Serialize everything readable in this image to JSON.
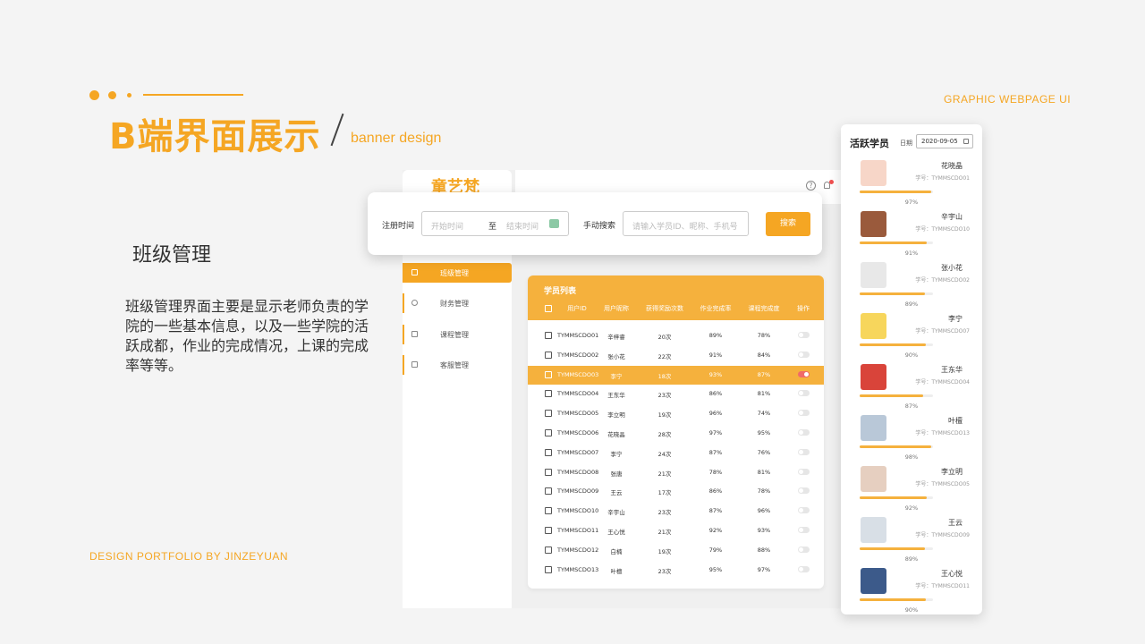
{
  "header": {
    "title": "B端界面展示",
    "subtitle": "banner design",
    "top_right": "GRAPHIC WEBPAGE UI",
    "footer": "DESIGN PORTFOLIO BY JINZEYUAN",
    "accent_color": "#f5a623"
  },
  "intro": {
    "title": "班级管理",
    "description": "班级管理界面主要是显示老师负责的学院的一些基本信息，以及一些学院的活跃成都，作业的完成情况，上课的完成率等等。"
  },
  "app": {
    "logo": "童艺梵",
    "help_icon": "?",
    "nav": [
      {
        "label": "班级管理",
        "icon": "clipboard-icon",
        "active": true
      },
      {
        "label": "财务管理",
        "icon": "yen-icon",
        "active": false
      },
      {
        "label": "课程管理",
        "icon": "book-icon",
        "active": false
      },
      {
        "label": "客服管理",
        "icon": "headset-icon",
        "active": false
      }
    ],
    "filter": {
      "reg_label": "注册时间",
      "start_placeholder": "开始时间",
      "to": "至",
      "end_placeholder": "结束时间",
      "search_label": "手动搜索",
      "search_placeholder": "请输入学员ID、昵称、手机号",
      "search_button": "搜索"
    },
    "table": {
      "title": "学员列表",
      "headers": [
        "用户ID",
        "用户昵称",
        "获得奖励次数",
        "作业完成率",
        "课程完成度",
        "操作"
      ],
      "rows": [
        {
          "id": "TYMMSCDO01",
          "name": "辛梓睿",
          "rewards": "20次",
          "homework": "89%",
          "course": "78%",
          "on": false,
          "selected": false
        },
        {
          "id": "TYMMSCDO02",
          "name": "张小花",
          "rewards": "22次",
          "homework": "91%",
          "course": "84%",
          "on": false,
          "selected": false
        },
        {
          "id": "TYMMSCDO03",
          "name": "李宁",
          "rewards": "18次",
          "homework": "93%",
          "course": "87%",
          "on": true,
          "selected": true
        },
        {
          "id": "TYMMSCDO04",
          "name": "王东华",
          "rewards": "23次",
          "homework": "86%",
          "course": "81%",
          "on": false,
          "selected": false
        },
        {
          "id": "TYMMSCDO05",
          "name": "李立明",
          "rewards": "19次",
          "homework": "96%",
          "course": "74%",
          "on": false,
          "selected": false
        },
        {
          "id": "TYMMSCDO06",
          "name": "花晓晶",
          "rewards": "28次",
          "homework": "97%",
          "course": "95%",
          "on": false,
          "selected": false
        },
        {
          "id": "TYMMSCDO07",
          "name": "李宁",
          "rewards": "24次",
          "homework": "87%",
          "course": "76%",
          "on": false,
          "selected": false
        },
        {
          "id": "TYMMSCDO08",
          "name": "张唐",
          "rewards": "21次",
          "homework": "78%",
          "course": "81%",
          "on": false,
          "selected": false
        },
        {
          "id": "TYMMSCDO09",
          "name": "王云",
          "rewards": "17次",
          "homework": "86%",
          "course": "78%",
          "on": false,
          "selected": false
        },
        {
          "id": "TYMMSCDO10",
          "name": "辛宇山",
          "rewards": "23次",
          "homework": "87%",
          "course": "96%",
          "on": false,
          "selected": false
        },
        {
          "id": "TYMMSCDO11",
          "name": "王心悦",
          "rewards": "21次",
          "homework": "92%",
          "course": "93%",
          "on": false,
          "selected": false
        },
        {
          "id": "TYMMSCDO12",
          "name": "白楠",
          "rewards": "19次",
          "homework": "79%",
          "course": "88%",
          "on": false,
          "selected": false
        },
        {
          "id": "TYMMSCDO13",
          "name": "叶檀",
          "rewards": "23次",
          "homework": "95%",
          "course": "97%",
          "on": false,
          "selected": false
        }
      ]
    }
  },
  "active_panel": {
    "title": "活跃学员",
    "date_label": "日期",
    "date": "2020-09-05",
    "students": [
      {
        "name": "花晓晶",
        "id": "学号：TYMMSCDO01",
        "percent": 97,
        "pct_label": "97%",
        "avatar_color": "#f7d6c8"
      },
      {
        "name": "辛宇山",
        "id": "学号：TYMMSCDO10",
        "percent": 91,
        "pct_label": "91%",
        "avatar_color": "#9a5a3c"
      },
      {
        "name": "张小花",
        "id": "学号：TYMMSCDO02",
        "percent": 89,
        "pct_label": "89%",
        "avatar_color": "#e8e8e8"
      },
      {
        "name": "李宁",
        "id": "学号：TYMMSCDO07",
        "percent": 90,
        "pct_label": "90%",
        "avatar_color": "#f7d65c"
      },
      {
        "name": "王东华",
        "id": "学号：TYMMSCDO04",
        "percent": 87,
        "pct_label": "87%",
        "avatar_color": "#d9443a"
      },
      {
        "name": "叶檀",
        "id": "学号：TYMMSCDO13",
        "percent": 98,
        "pct_label": "98%",
        "avatar_color": "#b9c8d8"
      },
      {
        "name": "李立明",
        "id": "学号：TYMMSCDO05",
        "percent": 92,
        "pct_label": "92%",
        "avatar_color": "#e6cfc0"
      },
      {
        "name": "王云",
        "id": "学号：TYMMSCDO09",
        "percent": 89,
        "pct_label": "89%",
        "avatar_color": "#d8dfe6"
      },
      {
        "name": "王心悦",
        "id": "学号：TYMMSCDO11",
        "percent": 90,
        "pct_label": "90%",
        "avatar_color": "#3c5a8a"
      }
    ]
  }
}
